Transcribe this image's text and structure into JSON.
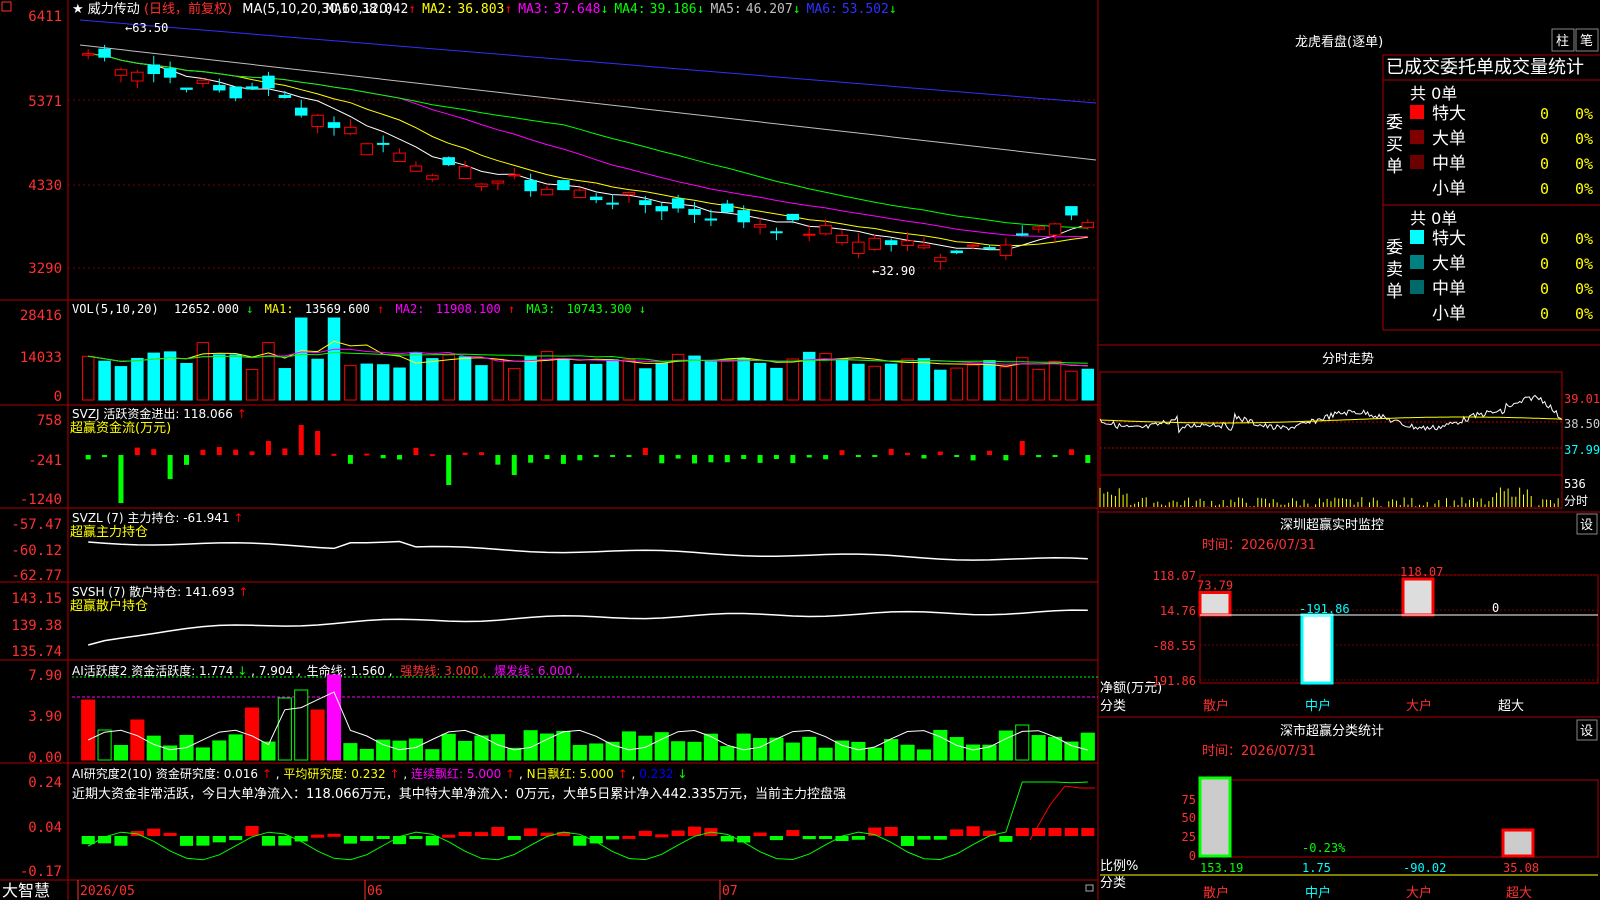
{
  "app": {
    "brand": "大智慧",
    "logo_glyph": "□"
  },
  "main_chart": {
    "title_star": "★",
    "stock_name": "威力传动",
    "period": "(日线，前复权)",
    "ma_header": "MA(5,10,20,30,60,120)",
    "ma": [
      {
        "label": "MA1:",
        "value": "38.042",
        "arrow": "↑",
        "color": "#ffffff"
      },
      {
        "label": "MA2:",
        "value": "36.803",
        "arrow": "↑",
        "color": "#ffff00"
      },
      {
        "label": "MA3:",
        "value": "37.648",
        "arrow": "↓",
        "color": "#ff00ff"
      },
      {
        "label": "MA4:",
        "value": "39.186",
        "arrow": "↓",
        "color": "#00ff00"
      },
      {
        "label": "MA5:",
        "value": "46.207",
        "arrow": "↓",
        "color": "#c0c0c0"
      },
      {
        "label": "MA6:",
        "value": "53.502",
        "arrow": "↓",
        "color": "#0000ff"
      }
    ],
    "high_note": "←63.50",
    "low_note": "←32.90",
    "y_labels": [
      "6411",
      "5371",
      "4330",
      "3290"
    ],
    "y_values": [
      64.11,
      53.71,
      43.3,
      32.9
    ]
  },
  "vol_panel": {
    "header": "VOL(5,10,20)",
    "value": "12652.000",
    "arrow": "↓",
    "ma": [
      {
        "label": "MA1:",
        "value": "13569.600",
        "arrow": "↑",
        "color": "#ffff00"
      },
      {
        "label": "MA2:",
        "value": "11908.100",
        "arrow": "↑",
        "color": "#ff00ff"
      },
      {
        "label": "MA3:",
        "value": "10743.300",
        "arrow": "↓",
        "color": "#00ff00"
      }
    ],
    "y_labels": [
      "28416",
      "14033",
      "0"
    ]
  },
  "svzj_panel": {
    "header": "SVZJ  活跃资金进出: 118.066",
    "arrow": "↑",
    "subtitle": "超赢资金流(万元)",
    "y_labels": [
      "758",
      "-241",
      "-1240"
    ]
  },
  "svzl_panel": {
    "header": "SVZL (7) 主力持仓: -61.941",
    "arrow": "↑",
    "subtitle": "超赢主力持仓",
    "y_labels": [
      "-57.47",
      "-60.12",
      "-62.77"
    ]
  },
  "svsh_panel": {
    "header": "SVSH (7) 散户持仓: 141.693",
    "arrow": "↑",
    "subtitle": "超赢散户持仓",
    "y_labels": [
      "143.15",
      "139.38",
      "135.74"
    ]
  },
  "ai_active_panel": {
    "header": "AI活跃度2 资金活跃度: 1.774",
    "arrow1": "↓",
    "val2": "7.904",
    "life_line": "生命线: 1.560",
    "strong_line": "强势线: 3.000",
    "burst_line": "爆发线: 6.000",
    "y_labels": [
      "7.90",
      "3.90",
      "0.00"
    ]
  },
  "ai_research_panel": {
    "header": "AI研究度2(10) 资金研究度: 0.016",
    "arrow1": "↑",
    "avg": "平均研究度: 0.232",
    "arrow2": "↑",
    "cont": "连续飘红: 5.000",
    "arrow3": "↑",
    "nday": "N日飘红: 5.000",
    "arrow4": "↑",
    "last": "0.232",
    "arrow5": "↓",
    "summary": "近期大资金非常活跃，今日大单净流入：118.066万元，其中特大单净流入：0万元，大单5日累计净入442.335万元，当前主力控盘强",
    "y_labels": [
      "0.24",
      "0.04",
      "-0.17"
    ]
  },
  "x_axis": {
    "labels": [
      "2026/05",
      "06",
      "07"
    ]
  },
  "right_panel": {
    "longhu": {
      "title": "龙虎看盘(逐单)",
      "btn1": "柱",
      "btn2": "笔"
    },
    "orders": {
      "header": "已成交委托单成交量统计",
      "buy": {
        "side_label": "委买单",
        "total": "共 0单",
        "rows": [
          {
            "name": "特大",
            "count": "0",
            "pct": "0%",
            "color": "#ff0000"
          },
          {
            "name": "大单",
            "count": "0",
            "pct": "0%",
            "color": "#800000"
          },
          {
            "name": "中单",
            "count": "0",
            "pct": "0%",
            "color": "#6a0000"
          },
          {
            "name": "小单",
            "count": "0",
            "pct": "0%",
            "color": "#000000"
          }
        ]
      },
      "sell": {
        "side_label": "委卖单",
        "total": "共 0单",
        "rows": [
          {
            "name": "特大",
            "count": "0",
            "pct": "0%",
            "color": "#00ffff"
          },
          {
            "name": "大单",
            "count": "0",
            "pct": "0%",
            "color": "#008080"
          },
          {
            "name": "中单",
            "count": "0",
            "pct": "0%",
            "color": "#006a6a"
          },
          {
            "name": "小单",
            "count": "0",
            "pct": "0%",
            "color": "#000000"
          }
        ]
      }
    },
    "intraday": {
      "title": "分时走势",
      "y_labels": [
        "39.01",
        "38.50",
        "37.99"
      ],
      "vol_label": "536",
      "vol_unit": "分时"
    },
    "monitor": {
      "title": "深圳超赢实时监控",
      "btn": "设",
      "time": "时间：2026/07/31",
      "y_labels": [
        "118.07",
        "14.76",
        "-88.55",
        "-191.86"
      ],
      "y_title": "净额(万元)",
      "x_title": "分类",
      "values": [
        {
          "name": "散户",
          "value": "73.79",
          "num": 73.79
        },
        {
          "name": "中户",
          "value": "-191.86",
          "num": -191.86
        },
        {
          "name": "大户",
          "value": "118.07",
          "num": 118.07
        },
        {
          "name": "超大",
          "value": "0",
          "num": 0
        }
      ]
    },
    "classify": {
      "title": "深市超赢分类统计",
      "btn": "设",
      "time": "时间：2026/07/31",
      "y_labels": [
        "75",
        "50",
        "25",
        "0"
      ],
      "y_title": "比例%",
      "x_title": "分类",
      "values": [
        {
          "name": "散户",
          "value": "153.19",
          "num": 153.19
        },
        {
          "name": "中户",
          "value": "1.75",
          "num": 1.75
        },
        {
          "name": "大户",
          "value": "-90.02",
          "num": -90.02
        },
        {
          "name": "超大",
          "value": "35.08",
          "num": 35.08
        }
      ],
      "mid_note": "-0.23%"
    }
  },
  "colors": {
    "up": "#ff0000",
    "down": "#00ffff",
    "grid": "#b00000",
    "axis_text": "#ff3030",
    "green": "#00ff00",
    "yellow": "#ffff00",
    "magenta": "#ff00ff"
  }
}
